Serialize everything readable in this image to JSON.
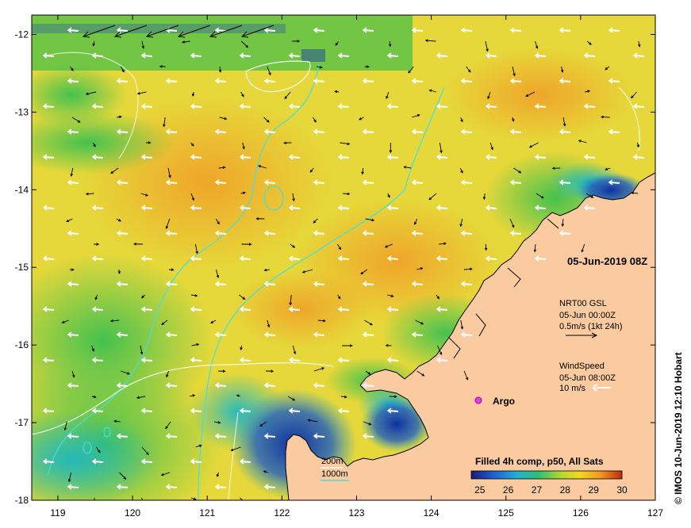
{
  "map": {
    "x_ticks": [
      "119",
      "120",
      "121",
      "122",
      "123",
      "124",
      "125",
      "126",
      "127"
    ],
    "y_ticks": [
      "-12",
      "-13",
      "-14",
      "-15",
      "-16",
      "-17",
      "-18"
    ],
    "lon_range": [
      118.65,
      127
    ],
    "lat_range": [
      -11.75,
      -18
    ]
  },
  "timestamp": "05-Jun-2019 08Z",
  "current_info": {
    "title": "NRT00 GSL",
    "time": "05-Jun 00:00Z",
    "scale": "0.5m/s (1kt 24h)"
  },
  "wind_info": {
    "title": "WindSpeed",
    "time": "05-Jun 08:00Z",
    "scale": "10 m/s"
  },
  "argo_label": "Argo",
  "depth_legend": {
    "shallow": "200m",
    "deep": "1000m"
  },
  "colorbar": {
    "title": "Filled 4h comp, p50, All Sats",
    "ticks": [
      "25",
      "26",
      "27",
      "28",
      "29",
      "30"
    ],
    "colors": [
      "#1a1a7a",
      "#1fa0e0",
      "#20c8a0",
      "#40c040",
      "#e8e020",
      "#f0a020",
      "#c03010"
    ]
  },
  "credit": "© IMOS 10-Jun-2019 12:10 Hobart"
}
